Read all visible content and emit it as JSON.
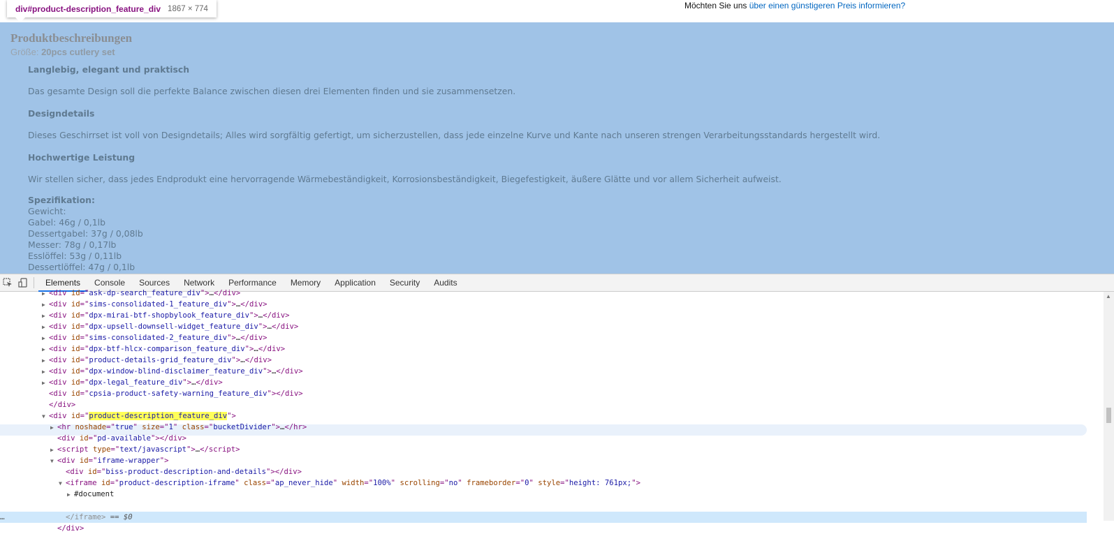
{
  "page": {
    "price_prefix": "Möchten Sie uns ",
    "price_link": "über einen günstigeren Preis informieren?",
    "tooltip": {
      "selector": "div#product-description_feature_div",
      "dimensions": "1867 × 774"
    },
    "description": {
      "title": "Produktbeschreibungen",
      "size_label": "Größe: ",
      "size_value": "20pcs cutlery set",
      "h1": "Langlebig, elegant und praktisch",
      "p1": "Das gesamte Design soll die perfekte Balance zwischen diesen drei Elementen finden und sie zusammensetzen.",
      "h2": "Designdetails",
      "p2": "Dieses Geschirrset ist voll von Designdetails; Alles wird sorgfältig gefertigt, um sicherzustellen, dass jede einzelne Kurve und Kante nach unseren strengen Verarbeitungsstandards hergestellt wird.",
      "h3": "Hochwertige Leistung",
      "p3": "Wir stellen sicher, dass jedes Endprodukt eine hervorragende Wärmebeständigkeit, Korrosionsbeständigkeit, Biegefestigkeit, äußere Glätte und vor allem Sicherheit aufweist.",
      "spec_title": "Spezifikation:",
      "spec_lines": [
        "Gewicht:",
        "Gabel: 46g / 0,1lb",
        "Dessertgabel: 37g / 0,08lb",
        "Messer: 78g / 0,17lb",
        "Esslöffel: 53g / 0,11lb",
        "Dessertlöffel: 47g / 0,1lb"
      ]
    }
  },
  "devtools": {
    "tabs": [
      "Elements",
      "Console",
      "Sources",
      "Network",
      "Performance",
      "Memory",
      "Application",
      "Security",
      "Audits"
    ],
    "active_tab": "Elements",
    "icons": {
      "inspect": "cursor-select-icon",
      "device": "device-toggle-icon"
    },
    "dom_collapsed_ids": [
      "ask-dp-search_feature_div",
      "sims-consolidated-1_feature_div",
      "dpx-mirai-btf-shopbylook_feature_div",
      "dpx-upsell-downsell-widget_feature_div",
      "sims-consolidated-2_feature_div",
      "dpx-btf-hlcx-comparison_feature_div",
      "product-details-grid_feature_div",
      "dpx-window-blind-disclaimer_feature_div",
      "dpx-legal_feature_div"
    ],
    "dom_cpsia_id": "cpsia-product-safety-warning_feature_div",
    "dom_close_div": "</div>",
    "dom_pd_id": "product-description_feature_div",
    "dom_hr": {
      "noshade": "true",
      "size": "1",
      "class": "bucketDivider"
    },
    "dom_pd_available": "pd-available",
    "dom_script_type": "text/javascript",
    "dom_iframe_wrapper": "iframe-wrapper",
    "dom_biss": "biss-product-description-and-details",
    "dom_iframe": {
      "id": "product-description-iframe",
      "class": "ap_never_hide",
      "width": "100%",
      "scrolling": "no",
      "frameborder": "0",
      "style": "height: 761px;"
    },
    "dom_document": "#document",
    "dom_iframe_close": "</iframe>",
    "dom_sel_marker": " == $0",
    "dom_ellipsis": "…"
  }
}
